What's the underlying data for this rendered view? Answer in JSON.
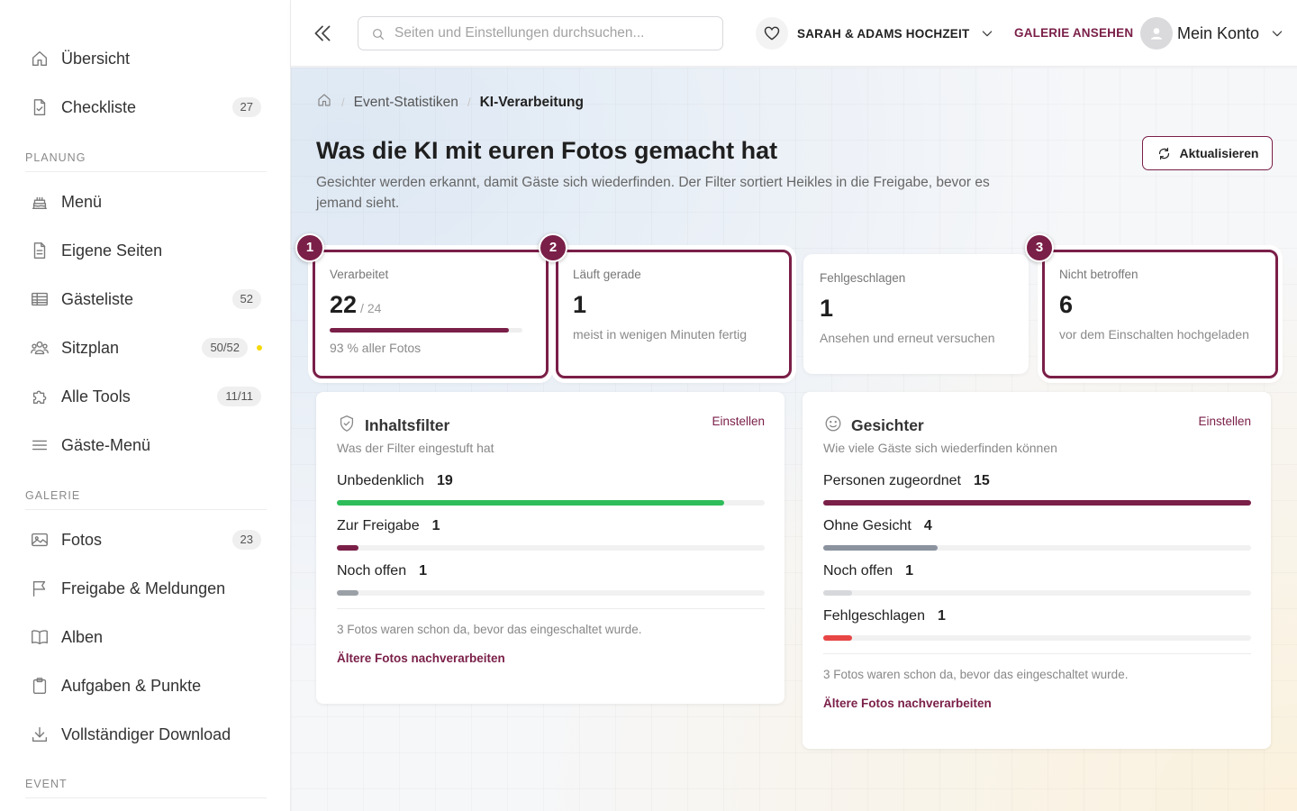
{
  "sidebar": {
    "items_top": [
      {
        "label": "Übersicht",
        "icon": "home-icon"
      },
      {
        "label": "Checkliste",
        "icon": "checklist-icon",
        "badge": "27"
      }
    ],
    "sections": [
      {
        "title": "PLANUNG",
        "items": [
          {
            "label": "Menü",
            "icon": "cake-icon"
          },
          {
            "label": "Eigene Seiten",
            "icon": "page-icon"
          },
          {
            "label": "Gästeliste",
            "icon": "table-icon",
            "badge": "52"
          },
          {
            "label": "Sitzplan",
            "icon": "people-icon",
            "badge": "50/52",
            "dot_color": "#f5d90a"
          },
          {
            "label": "Alle Tools",
            "icon": "puzzle-icon",
            "badge": "11/11"
          },
          {
            "label": "Gäste-Menü",
            "icon": "menu-lines-icon"
          }
        ]
      },
      {
        "title": "GALERIE",
        "items": [
          {
            "label": "Fotos",
            "icon": "image-icon",
            "badge": "23"
          },
          {
            "label": "Freigabe & Meldungen",
            "icon": "flag-icon"
          },
          {
            "label": "Alben",
            "icon": "book-icon"
          },
          {
            "label": "Aufgaben & Punkte",
            "icon": "clipboard-icon"
          },
          {
            "label": "Vollständiger Download",
            "icon": "download-icon"
          }
        ]
      },
      {
        "title": "EVENT",
        "items": []
      }
    ]
  },
  "topbar": {
    "search_placeholder": "Seiten und Einstellungen durchsuchen...",
    "event_name": "SARAH & ADAMS HOCHZEIT",
    "gallery_link": "GALERIE ANSEHEN",
    "account_label": "Mein Konto"
  },
  "breadcrumb": {
    "items": [
      "Event-Statistiken"
    ],
    "current": "KI-Verarbeitung"
  },
  "page": {
    "title": "Was die KI mit euren Fotos gemacht hat",
    "subtitle": "Gesichter werden erkannt, damit Gäste sich wiederfinden. Der Filter sortiert Heikles in die Freigabe, bevor es jemand sieht.",
    "refresh_label": "Aktualisieren"
  },
  "stats": [
    {
      "step": "1",
      "label": "Verarbeitet",
      "value": "22",
      "total": "/ 24",
      "progress": 0.93,
      "hint": "93 % aller Fotos",
      "highlighted": true
    },
    {
      "step": "2",
      "label": "Läuft gerade",
      "value": "1",
      "hint": "meist in wenigen Minuten fertig",
      "highlighted": true
    },
    {
      "step": "",
      "label": "Fehlgeschlagen",
      "value": "1",
      "hint": "Ansehen und erneut versuchen",
      "highlighted": false
    },
    {
      "step": "3",
      "label": "Nicht betroffen",
      "value": "6",
      "hint": "vor dem Einschalten hochgeladen",
      "highlighted": true
    }
  ],
  "colors": {
    "accent": "#7a1f48",
    "success": "#2ebd5a",
    "muted": "#9aa0a6",
    "danger": "#e84545",
    "slate": "#8a939e",
    "light_gray": "#d6d8db"
  },
  "panels": [
    {
      "id": "content-filter",
      "icon": "shield-check-icon",
      "title": "Inhaltsfilter",
      "subtitle": "Was der Filter eingestuft hat",
      "config_label": "Einstellen",
      "total": 21,
      "rows": [
        {
          "label": "Unbedenklich",
          "count": 19,
          "color": "#2ebd5a"
        },
        {
          "label": "Zur Freigabe",
          "count": 1,
          "color": "#7a1f48"
        },
        {
          "label": "Noch offen",
          "count": 1,
          "color": "#9aa0a6"
        }
      ],
      "note": "3 Fotos waren schon da, bevor das eingeschaltet wurde.",
      "action": "Ältere Fotos nachverarbeiten"
    },
    {
      "id": "faces",
      "icon": "smiley-icon",
      "title": "Gesichter",
      "subtitle": "Wie viele Gäste sich wiederfinden können",
      "config_label": "Einstellen",
      "total": 15,
      "rows": [
        {
          "label": "Personen zugeordnet",
          "count": 15,
          "color": "#7a1f48"
        },
        {
          "label": "Ohne Gesicht",
          "count": 4,
          "color": "#8a939e"
        },
        {
          "label": "Noch offen",
          "count": 1,
          "color": "#d6d8db"
        },
        {
          "label": "Fehlgeschlagen",
          "count": 1,
          "color": "#e84545"
        }
      ],
      "note": "3 Fotos waren schon da, bevor das eingeschaltet wurde.",
      "action": "Ältere Fotos nachverarbeiten"
    }
  ]
}
